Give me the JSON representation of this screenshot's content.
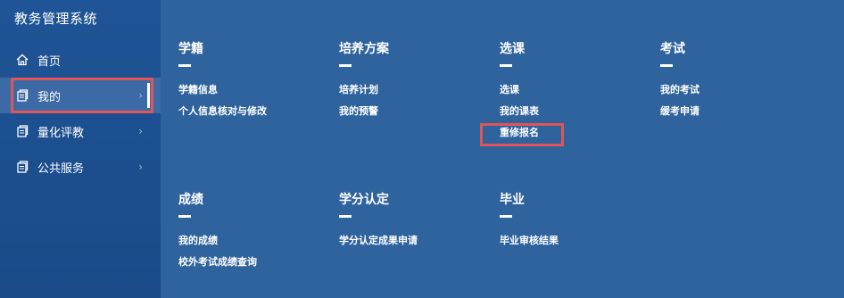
{
  "app": {
    "title": "教务管理系统"
  },
  "sidebar": {
    "items": [
      {
        "label": "首页",
        "icon": "home-icon",
        "chevron": false
      },
      {
        "label": "我的",
        "icon": "document-icon",
        "chevron": true,
        "active": true
      },
      {
        "label": "量化评教",
        "icon": "document-icon",
        "chevron": true
      },
      {
        "label": "公共服务",
        "icon": "document-icon",
        "chevron": true
      }
    ]
  },
  "menu": {
    "groups": [
      {
        "title": "学籍",
        "links": [
          "学籍信息",
          "个人信息核对与修改"
        ]
      },
      {
        "title": "培养方案",
        "links": [
          "培养计划",
          "我的预警"
        ]
      },
      {
        "title": "选课",
        "links": [
          "选课",
          "我的课表",
          "重修报名"
        ]
      },
      {
        "title": "考试",
        "links": [
          "我的考试",
          "缓考申请"
        ]
      },
      {
        "title": "成绩",
        "links": [
          "我的成绩",
          "校外考试成绩查询"
        ]
      },
      {
        "title": "学分认定",
        "links": [
          "学分认定成果申请"
        ]
      },
      {
        "title": "毕业",
        "links": [
          "毕业审核结果"
        ]
      }
    ]
  },
  "colors": {
    "highlight": "#e05555",
    "sidebar": "#1f5496",
    "main": "#2f639d"
  }
}
